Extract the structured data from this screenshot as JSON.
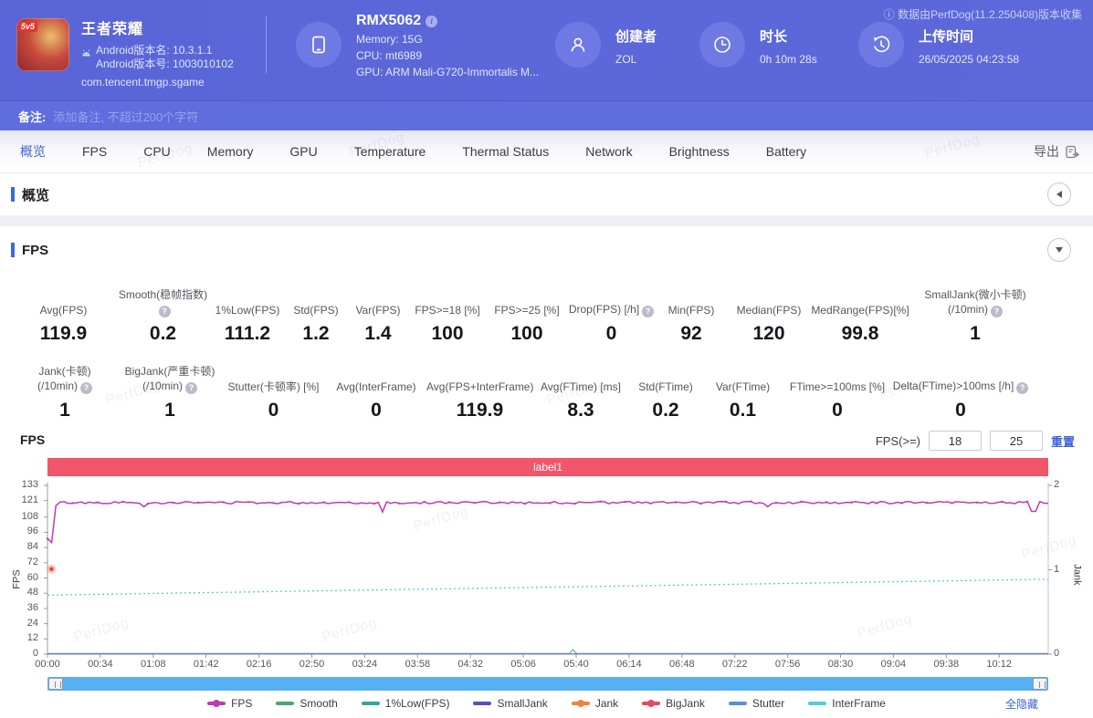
{
  "header": {
    "app": {
      "badge": "5v5",
      "name": "王者荣耀",
      "android_version_name": "Android版本名: 10.3.1.1",
      "android_version_code": "Android版本号: 1003010102",
      "package": "com.tencent.tmgp.sgame"
    },
    "device": {
      "model": "RMX5062",
      "memory": "Memory: 15G",
      "cpu": "CPU: mt6989",
      "gpu": "GPU: ARM Mali-G720-Immortalis M..."
    },
    "creator": {
      "label": "创建者",
      "value": "ZOL"
    },
    "duration": {
      "label": "时长",
      "value": "0h 10m 28s"
    },
    "upload": {
      "label": "上传时间",
      "value": "26/05/2025 04:23:58"
    },
    "version_note": "ⓘ 数据由PerfDog(11.2.250408)版本收集"
  },
  "note_bar": {
    "label": "备注:",
    "placeholder": "添加备注, 不超过200个字符"
  },
  "tabs": {
    "items": [
      "概览",
      "FPS",
      "CPU",
      "Memory",
      "GPU",
      "Temperature",
      "Thermal Status",
      "Network",
      "Brightness",
      "Battery"
    ],
    "active_index": 0,
    "export_label": "导出"
  },
  "sections": {
    "overview_title": "概览",
    "fps_title": "FPS"
  },
  "stats_row1": [
    {
      "label": "Avg(FPS)",
      "value": "119.9"
    },
    {
      "label": "Smooth(稳帧指数)",
      "help": true,
      "value": "0.2"
    },
    {
      "label": "1%Low(FPS)",
      "value": "111.2"
    },
    {
      "label": "Std(FPS)",
      "value": "1.2"
    },
    {
      "label": "Var(FPS)",
      "value": "1.4"
    },
    {
      "label": "FPS>=18 [%]",
      "value": "100"
    },
    {
      "label": "FPS>=25 [%]",
      "value": "100"
    },
    {
      "label": "Drop(FPS) [/h]",
      "help": true,
      "value": "0"
    },
    {
      "label": "Min(FPS)",
      "value": "92"
    },
    {
      "label": "Median(FPS)",
      "value": "120"
    },
    {
      "label": "MedRange(FPS)[%]",
      "value": "99.8"
    },
    {
      "label": "SmallJank(微小卡顿)",
      "label2": "(/10min)",
      "help": true,
      "value": "1"
    }
  ],
  "stats_row2": [
    {
      "label": "Jank(卡顿)",
      "label2": "(/10min)",
      "help": true,
      "value": "1"
    },
    {
      "label": "BigJank(严重卡顿)",
      "label2": "(/10min)",
      "help": true,
      "value": "1"
    },
    {
      "label": "Stutter(卡顿率) [%]",
      "value": "0"
    },
    {
      "label": "Avg(InterFrame)",
      "value": "0"
    },
    {
      "label": "Avg(FPS+InterFrame)",
      "value": "119.9"
    },
    {
      "label": "Avg(FTime) [ms]",
      "value": "8.3"
    },
    {
      "label": "Std(FTime)",
      "value": "0.2"
    },
    {
      "label": "Var(FTime)",
      "value": "0.1"
    },
    {
      "label": "FTime>=100ms [%]",
      "value": "0"
    },
    {
      "label": "Delta(FTime)>100ms [/h]",
      "help": true,
      "value": "0"
    }
  ],
  "chart_controls": {
    "chart_title": "FPS",
    "threshold_label": "FPS(>=)",
    "threshold1": "18",
    "threshold2": "25",
    "reset_label": "重置"
  },
  "chart_data": {
    "type": "line",
    "banner_label": "label1",
    "left_axis": {
      "label": "FPS",
      "ticks": [
        133,
        121,
        108,
        96,
        84,
        72,
        60,
        48,
        36,
        24,
        12,
        0
      ],
      "max": 133
    },
    "right_axis": {
      "label": "Jank",
      "ticks": [
        2,
        1,
        0
      ],
      "max": 2
    },
    "x_ticks": [
      "00:00",
      "00:34",
      "01:08",
      "01:42",
      "02:16",
      "02:50",
      "03:24",
      "03:58",
      "04:32",
      "05:06",
      "05:40",
      "06:14",
      "06:48",
      "07:22",
      "07:56",
      "08:30",
      "09:04",
      "09:38",
      "10:12"
    ],
    "series": [
      {
        "name": "FPS",
        "color": "#c03ab2",
        "dot": true,
        "baseline": 119.4,
        "noise": 0.9,
        "start_values": [
          91,
          88,
          117
        ],
        "dips": [
          {
            "frac": 0.335,
            "value": 112
          },
          {
            "frac": 0.985,
            "value": 112.5
          }
        ]
      },
      {
        "name": "Smooth",
        "color": "#48a968",
        "baseline": 0.5,
        "bump": {
          "frac": 0.525,
          "value": 3.5
        }
      },
      {
        "name": "1%Low(FPS)",
        "color": "#2ba8a2",
        "baseline": 0.3
      },
      {
        "name": "SmallJank",
        "color": "#4f52c8",
        "baseline": 0.15
      },
      {
        "name": "Jank",
        "color": "#ef8340",
        "dot": true,
        "baseline": 0.15,
        "marker": {
          "frac": 0.004,
          "value": 67
        }
      },
      {
        "name": "BigJank",
        "color": "#e5485c",
        "dot": true,
        "baseline": 0.15
      },
      {
        "name": "Stutter",
        "color": "#5c8fd6",
        "baseline": 0.15
      },
      {
        "name": "InterFrame",
        "color": "#4ccfd9",
        "line_from": 46.5,
        "line_to": 59,
        "dashed": true
      }
    ],
    "hide_all_label": "全隐藏"
  },
  "watermark": "PerfDog"
}
